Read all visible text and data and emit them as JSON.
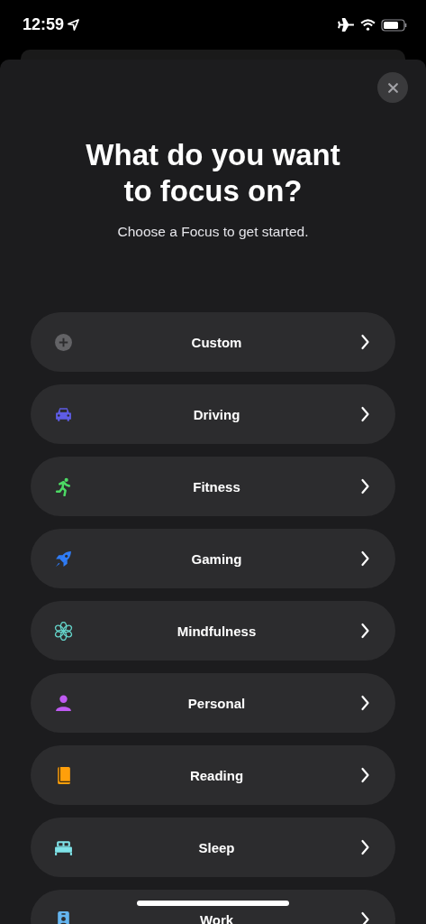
{
  "status_bar": {
    "time": "12:59"
  },
  "sheet": {
    "title": "What do you want to focus on?",
    "subtitle": "Choose a Focus to get started."
  },
  "focus_options": [
    {
      "label": "Custom",
      "kind": "plus",
      "color": "#636366"
    },
    {
      "label": "Driving",
      "kind": "car",
      "color": "#5e5ce6"
    },
    {
      "label": "Fitness",
      "kind": "runner",
      "color": "#4cd964"
    },
    {
      "label": "Gaming",
      "kind": "rocket",
      "color": "#2f7cf6"
    },
    {
      "label": "Mindfulness",
      "kind": "flower",
      "color": "#64d2c8"
    },
    {
      "label": "Personal",
      "kind": "person",
      "color": "#bf5af2"
    },
    {
      "label": "Reading",
      "kind": "book",
      "color": "#ff9f0a"
    },
    {
      "label": "Sleep",
      "kind": "bed",
      "color": "#7fe3e8"
    },
    {
      "label": "Work",
      "kind": "badge",
      "color": "#64b5f0"
    }
  ]
}
